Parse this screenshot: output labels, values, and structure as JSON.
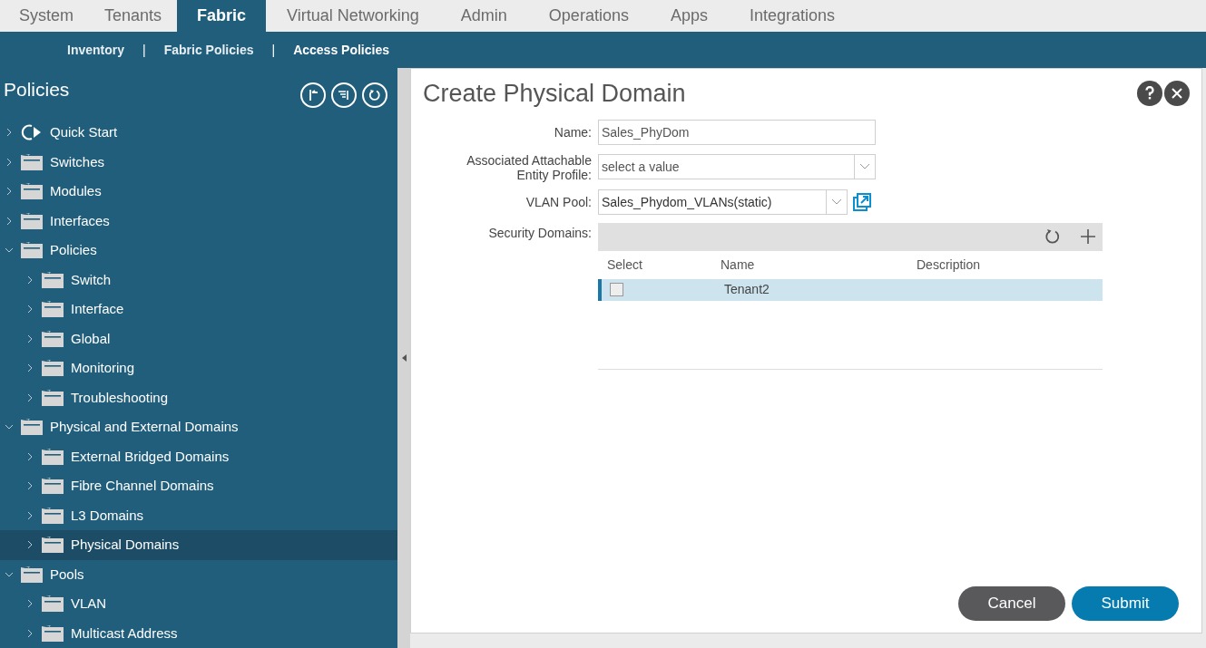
{
  "tabs": [
    {
      "label": "System",
      "selected": false
    },
    {
      "label": "Tenants",
      "selected": false
    },
    {
      "label": "Fabric",
      "selected": true
    },
    {
      "label": "Virtual Networking",
      "selected": false
    },
    {
      "label": "Admin",
      "selected": false
    },
    {
      "label": "Operations",
      "selected": false
    },
    {
      "label": "Apps",
      "selected": false
    },
    {
      "label": "Integrations",
      "selected": false
    }
  ],
  "subnav": {
    "separator": "|",
    "items": [
      {
        "label": "Inventory",
        "selected": false
      },
      {
        "label": "Fabric Policies",
        "selected": false
      },
      {
        "label": "Access Policies",
        "selected": true
      }
    ]
  },
  "sidebar": {
    "title": "Policies",
    "tree": [
      {
        "label": "Quick Start",
        "kind": "start",
        "expanded": false,
        "selected": false
      },
      {
        "label": "Switches",
        "kind": "folder",
        "expanded": false,
        "selected": false
      },
      {
        "label": "Modules",
        "kind": "folder",
        "expanded": false,
        "selected": false
      },
      {
        "label": "Interfaces",
        "kind": "folder",
        "expanded": false,
        "selected": false
      },
      {
        "label": "Policies",
        "kind": "folder",
        "expanded": true,
        "selected": false,
        "children": [
          {
            "label": "Switch",
            "kind": "folder",
            "expanded": false,
            "selected": false
          },
          {
            "label": "Interface",
            "kind": "folder",
            "expanded": false,
            "selected": false
          },
          {
            "label": "Global",
            "kind": "folder",
            "expanded": false,
            "selected": false
          },
          {
            "label": "Monitoring",
            "kind": "folder",
            "expanded": false,
            "selected": false
          },
          {
            "label": "Troubleshooting",
            "kind": "folder",
            "expanded": false,
            "selected": false
          }
        ]
      },
      {
        "label": "Physical and External Domains",
        "kind": "folder",
        "expanded": true,
        "selected": false,
        "children": [
          {
            "label": "External Bridged Domains",
            "kind": "folder",
            "expanded": false,
            "selected": false
          },
          {
            "label": "Fibre Channel Domains",
            "kind": "folder",
            "expanded": false,
            "selected": false
          },
          {
            "label": "L3 Domains",
            "kind": "folder",
            "expanded": false,
            "selected": false
          },
          {
            "label": "Physical Domains",
            "kind": "folder",
            "expanded": false,
            "selected": true
          }
        ]
      },
      {
        "label": "Pools",
        "kind": "folder",
        "expanded": true,
        "selected": false,
        "children": [
          {
            "label": "VLAN",
            "kind": "folder",
            "expanded": false,
            "selected": false
          },
          {
            "label": "Multicast Address",
            "kind": "folder",
            "expanded": false,
            "selected": false
          }
        ]
      }
    ]
  },
  "dialog": {
    "title": "Create Physical Domain",
    "name": {
      "label": "Name:",
      "value": "Sales_PhyDom"
    },
    "aep": {
      "label_lines": [
        "Associated Attachable",
        "Entity Profile:"
      ],
      "placeholder": "select a value"
    },
    "vlan_pool": {
      "label": "VLAN Pool:",
      "value": "Sales_Phydom_VLANs(static)"
    },
    "security_domains": {
      "label": "Security Domains:",
      "columns": [
        "Select",
        "Name",
        "Description"
      ],
      "rows": [
        {
          "name": "Tenant2",
          "description": "",
          "checked": false,
          "selected": true
        }
      ]
    },
    "buttons": [
      {
        "label": "Cancel",
        "kind": "secondary"
      },
      {
        "label": "Submit",
        "kind": "primary"
      }
    ]
  }
}
